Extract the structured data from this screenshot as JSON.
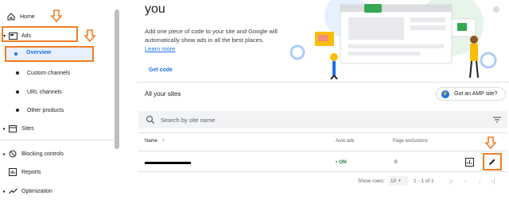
{
  "sidebar": {
    "home": "Home",
    "ads": "Ads",
    "overview": "Overview",
    "custom_channels": "Custom channels",
    "url_channels": "URL channels",
    "other_products": "Other products",
    "sites": "Sites",
    "blocking_controls": "Blocking controls",
    "reports": "Reports",
    "optimization": "Optimization"
  },
  "hero": {
    "title": "you",
    "description": "Add one piece of code to your site and Google will automatically show ads in all the best places.",
    "learn_more": "Learn more",
    "get_code": "Get code"
  },
  "sites": {
    "title": "All your sites",
    "amp_button": "Got an AMP site?",
    "search_placeholder": "Search by site name",
    "columns": {
      "name": "Name",
      "auto_ads": "Auto ads",
      "page_exclusions": "Page exclusions"
    },
    "rows": [
      {
        "auto_ads": "ON",
        "page_exclusions": "0"
      }
    ],
    "footer": {
      "show_rows_label": "Show rows:",
      "rows_value": "10",
      "range": "1 - 1 of 1"
    }
  },
  "colors": {
    "accent": "#1a73e8",
    "highlight": "#ef7d22",
    "status_on": "#188038"
  }
}
